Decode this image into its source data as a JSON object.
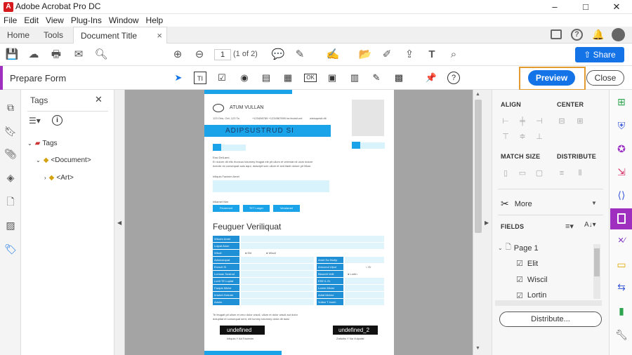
{
  "app": {
    "title": "Adobe Acrobat Pro DC",
    "window_controls": [
      "–",
      "□",
      "✕"
    ]
  },
  "menu": [
    "File",
    "Edit",
    "View",
    "Plug-Ins",
    "Window",
    "Help"
  ],
  "tabs": {
    "home": "Home",
    "tools": "Tools",
    "document": "Document Title",
    "close": "×"
  },
  "toolbar": {
    "page_current": "1",
    "page_total": "(1 of 2)",
    "share_label": "Share"
  },
  "prepare_form": {
    "title": "Prepare Form",
    "preview_label": "Preview",
    "close_label": "Close"
  },
  "tags_panel": {
    "title": "Tags",
    "close": "✕",
    "tree": [
      {
        "label": "Tags",
        "level": 0
      },
      {
        "label": "<Document>",
        "level": 1
      },
      {
        "label": "<Art>",
        "level": 2
      }
    ]
  },
  "document": {
    "company": "ATUM VULLAN",
    "address": "123 Oris, Oct, 123 Ta",
    "phone": "+123456789 +1234567890",
    "email": "lor.feuisit.unt",
    "web": "wisiuquisit.dit",
    "banner": "ADIPSUSTRUD SI",
    "greeting": "Essi DelLami,",
    "body1": "Er dolore dit elis rhoncus tolummy feugiat ele pit ullum et veleniat nil ulum dolore",
    "body2": "dolorte do consequat auis aqui, duiscipit scin ullum et sed ilanit dolore pit lillum.",
    "label_amet": "Iriliquis Facinim Amet",
    "label_nim": "Iriliamet Nim",
    "buttons": [
      "Feummod",
      "TET Lorger",
      "Vendamet"
    ],
    "section_title": "Feuguer Veriliquat",
    "fields_left": [
      "Wiscim Amet",
      "Lutpat Atum",
      "Wiscil",
      "Adionsequat",
      "Erosvit Si",
      "Lumsan Sustrud",
      "Lorril TE Luptat",
      "Facipis Minist",
      "Irriahrit Delente",
      "Aduim"
    ],
    "fields_right": [
      "Amet Ea Modip",
      "Amconul Ulput",
      "Blaorett Velit",
      "ESE IL Er",
      "Lorem Minist",
      "Adiat Meirne",
      "Vullan T Inonh"
    ],
    "radio_1": "Elit",
    "radio_2": "Wiscil",
    "radio_3": "Er",
    "radio_4": "Lortin",
    "footer1": "Te feugait pit ullum et vero dolor wiscil, ullum et dolor wiscil aut dolor",
    "footer2": "dolupltat et consequat sent, elit lummy tolummy dolor dit duisi",
    "field_undefined": "undefined",
    "field_undefined_2": "undefined_2",
    "sig_left": "Iriliquis Y Ad Facimim",
    "sig_right": "Zattultis Y Na Vulputat"
  },
  "right_panel": {
    "align": "ALIGN",
    "center": "CENTER",
    "match_size": "MATCH SIZE",
    "distribute": "DISTRIBUTE",
    "more": "More",
    "fields": "FIELDS",
    "page_label": "Page 1",
    "field_items": [
      "Elit",
      "Wiscil",
      "Lortin"
    ],
    "distribute_button": "Distribute..."
  },
  "colors": {
    "accent": "#1473e6",
    "prepare_form_purple": "#9e2fbf",
    "highlight": "#e39a2e",
    "doc_blue": "#1aa3e8"
  }
}
